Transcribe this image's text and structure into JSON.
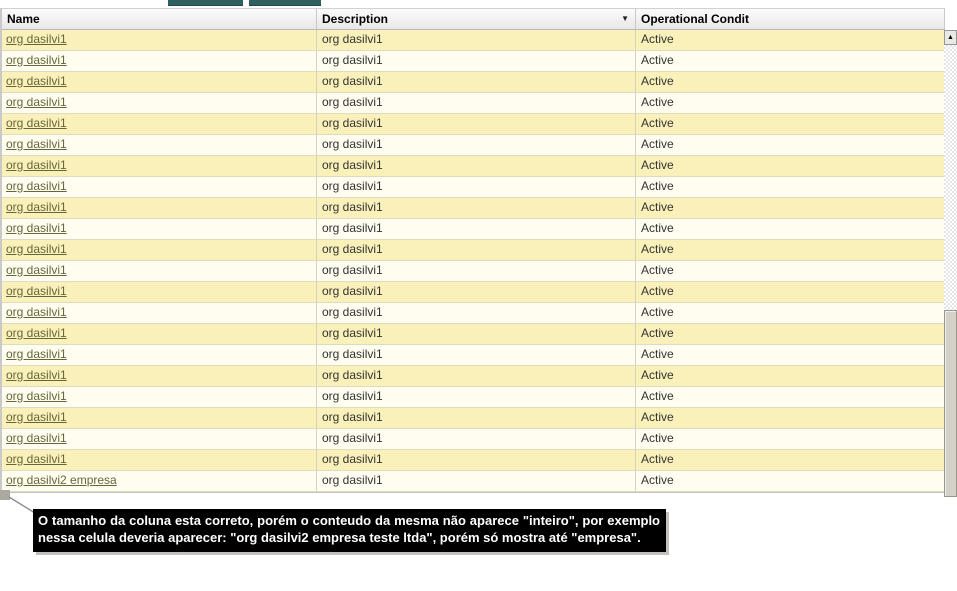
{
  "table": {
    "columns": [
      {
        "label": "Name"
      },
      {
        "label": "Description",
        "sort_icon": "▼"
      },
      {
        "label": "Operational Condit"
      }
    ],
    "rows": [
      {
        "name": "org dasilvi1",
        "description": "org dasilvi1",
        "condition": "Active"
      },
      {
        "name": "org dasilvi1",
        "description": "org dasilvi1",
        "condition": "Active"
      },
      {
        "name": "org dasilvi1",
        "description": "org dasilvi1",
        "condition": "Active"
      },
      {
        "name": "org dasilvi1",
        "description": "org dasilvi1",
        "condition": "Active"
      },
      {
        "name": "org dasilvi1",
        "description": "org dasilvi1",
        "condition": "Active"
      },
      {
        "name": "org dasilvi1",
        "description": "org dasilvi1",
        "condition": "Active"
      },
      {
        "name": "org dasilvi1",
        "description": "org dasilvi1",
        "condition": "Active"
      },
      {
        "name": "org dasilvi1",
        "description": "org dasilvi1",
        "condition": "Active"
      },
      {
        "name": "org dasilvi1",
        "description": "org dasilvi1",
        "condition": "Active"
      },
      {
        "name": "org dasilvi1",
        "description": "org dasilvi1",
        "condition": "Active"
      },
      {
        "name": "org dasilvi1",
        "description": "org dasilvi1",
        "condition": "Active"
      },
      {
        "name": "org dasilvi1",
        "description": "org dasilvi1",
        "condition": "Active"
      },
      {
        "name": "org dasilvi1",
        "description": "org dasilvi1",
        "condition": "Active"
      },
      {
        "name": "org dasilvi1",
        "description": "org dasilvi1",
        "condition": "Active"
      },
      {
        "name": "org dasilvi1",
        "description": "org dasilvi1",
        "condition": "Active"
      },
      {
        "name": "org dasilvi1",
        "description": "org dasilvi1",
        "condition": "Active"
      },
      {
        "name": "org dasilvi1",
        "description": "org dasilvi1",
        "condition": "Active"
      },
      {
        "name": "org dasilvi1",
        "description": "org dasilvi1",
        "condition": "Active"
      },
      {
        "name": "org dasilvi1",
        "description": "org dasilvi1",
        "condition": "Active"
      },
      {
        "name": "org dasilvi1",
        "description": "org dasilvi1",
        "condition": "Active"
      },
      {
        "name": "org dasilvi1",
        "description": "org dasilvi1",
        "condition": "Active"
      },
      {
        "name": "org dasilvi2 empresa",
        "description": "org dasilvi1",
        "condition": "Active"
      }
    ]
  },
  "scrollbar": {
    "up_icon": "▲"
  },
  "tooltip": {
    "text": "O tamanho da coluna esta correto, porém o conteudo da mesma não aparece \"inteiro\", por exemplo nessa celula deveria aparecer: \"org dasilvi2 empresa teste ltda\", porém só mostra até \"empresa\"."
  },
  "colors": {
    "teal": "#2E6060",
    "row_dark": "#FAF1BA",
    "row_light": "#FFFDF0",
    "link": "#66663A",
    "tooltip_bg": "#000000",
    "tooltip_text": "#FFFFFF"
  }
}
